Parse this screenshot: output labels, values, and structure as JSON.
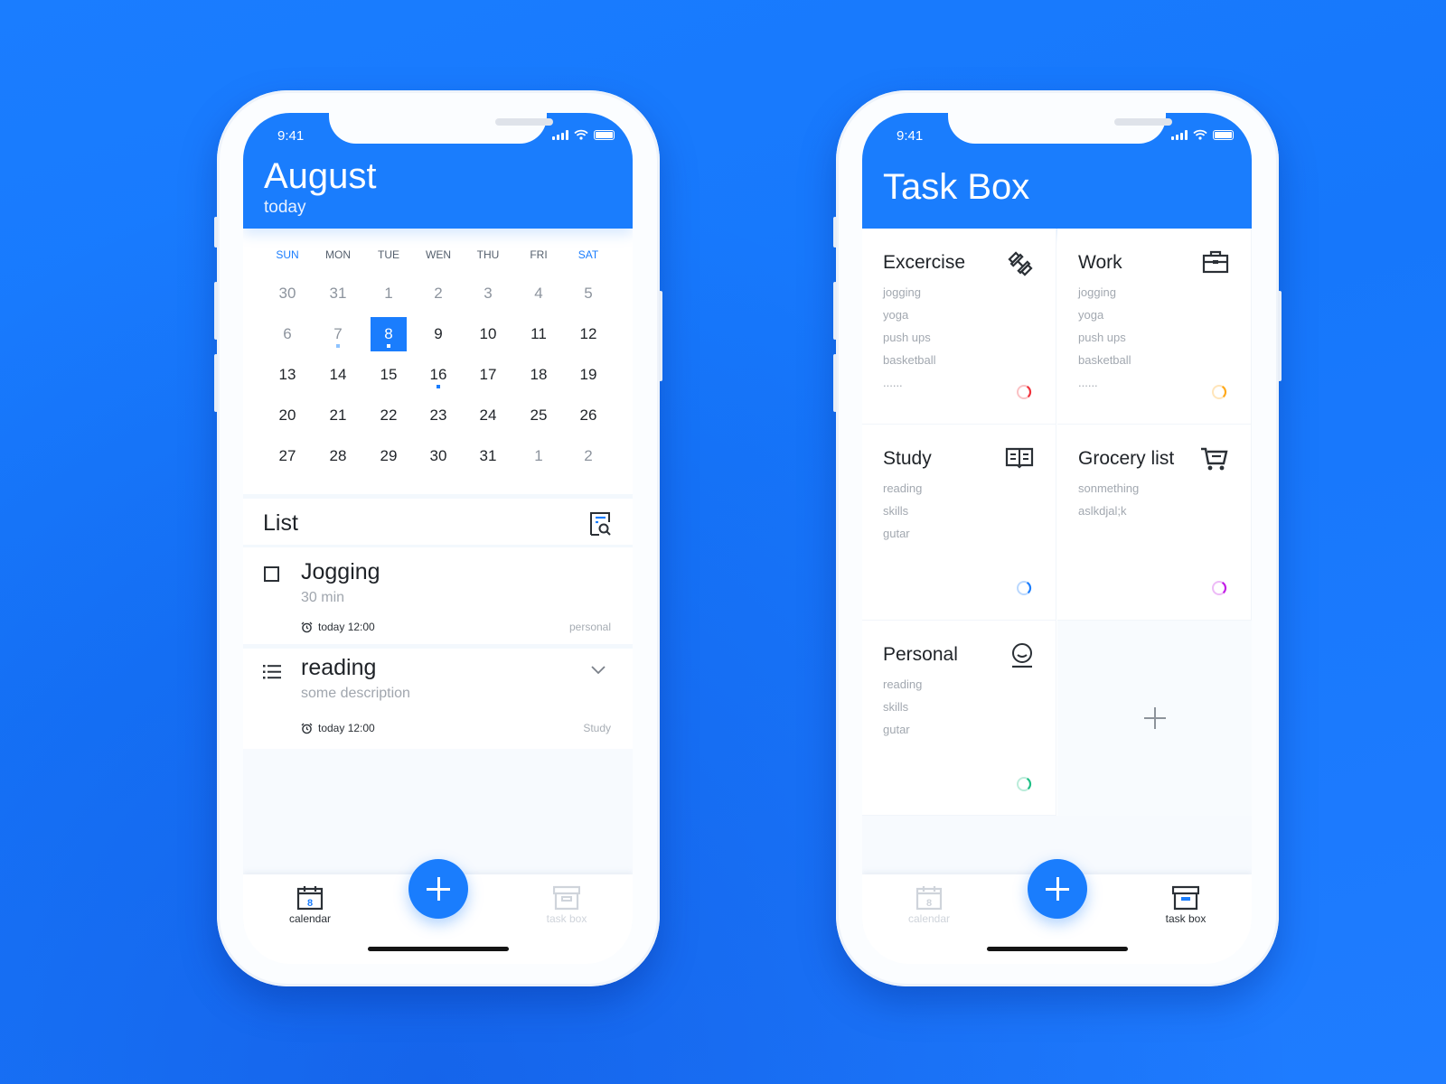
{
  "colors": {
    "brand": "#1a7dfd",
    "background": "#1a7dff"
  },
  "calendar_phone": {
    "status": {
      "time": "9:41"
    },
    "header": {
      "title": "August",
      "subtitle": "today"
    },
    "weekdays": [
      "SUN",
      "MON",
      "TUE",
      "WEN",
      "THU",
      "FRI",
      "SAT"
    ],
    "weeks": [
      [
        {
          "d": "30",
          "m": true
        },
        {
          "d": "31",
          "m": true
        },
        {
          "d": "1",
          "m": true
        },
        {
          "d": "2",
          "m": true
        },
        {
          "d": "3",
          "m": true
        },
        {
          "d": "4",
          "m": true
        },
        {
          "d": "5",
          "m": true
        }
      ],
      [
        {
          "d": "6",
          "m": true
        },
        {
          "d": "7",
          "m": true,
          "dot": "light"
        },
        {
          "d": "8",
          "sel": true,
          "dot": "white"
        },
        {
          "d": "9"
        },
        {
          "d": "10"
        },
        {
          "d": "11"
        },
        {
          "d": "12"
        }
      ],
      [
        {
          "d": "13"
        },
        {
          "d": "14"
        },
        {
          "d": "15"
        },
        {
          "d": "16",
          "dot": "blue"
        },
        {
          "d": "17"
        },
        {
          "d": "18"
        },
        {
          "d": "19"
        }
      ],
      [
        {
          "d": "20"
        },
        {
          "d": "21"
        },
        {
          "d": "22"
        },
        {
          "d": "23"
        },
        {
          "d": "24"
        },
        {
          "d": "25"
        },
        {
          "d": "26"
        }
      ],
      [
        {
          "d": "27"
        },
        {
          "d": "28"
        },
        {
          "d": "29"
        },
        {
          "d": "30"
        },
        {
          "d": "31"
        },
        {
          "d": "1",
          "m": true
        },
        {
          "d": "2",
          "m": true
        }
      ]
    ],
    "list": {
      "title": "List",
      "items": [
        {
          "title": "Jogging",
          "desc": "30 min",
          "time": "today 12:00",
          "tag": "personal",
          "icon": "checkbox-icon"
        },
        {
          "title": "reading",
          "desc": "some description",
          "time": "today 12:00",
          "tag": "Study",
          "icon": "list-icon"
        }
      ]
    },
    "nav": {
      "calendar": "calendar",
      "taskbox": "task box",
      "calendar_day": "8",
      "active": "calendar"
    }
  },
  "taskbox_phone": {
    "status": {
      "time": "9:41"
    },
    "header": {
      "title": "Task Box"
    },
    "tiles": [
      {
        "title": "Excercise",
        "icon": "dumbbell-icon",
        "items": [
          "jogging",
          "yoga",
          "push ups",
          "basketball",
          "......"
        ],
        "ring_color": "#f0323c",
        "progress": 0.3
      },
      {
        "title": "Work",
        "icon": "briefcase-icon",
        "items": [
          "jogging",
          "yoga",
          "push ups",
          "basketball",
          "......"
        ],
        "ring_color": "#ffa91a",
        "progress": 0.3
      },
      {
        "title": "Study",
        "icon": "book-icon",
        "items": [
          "reading",
          "skills",
          "gutar"
        ],
        "ring_color": "#1a7dfd",
        "progress": 0.3
      },
      {
        "title": "Grocery list",
        "icon": "cart-icon",
        "items": [
          "sonmething",
          "aslkdjal;k"
        ],
        "ring_color": "#c21ee6",
        "progress": 0.3
      },
      {
        "title": "Personal",
        "icon": "face-icon",
        "items": [
          "reading",
          "skills",
          "gutar"
        ],
        "ring_color": "#1fbf86",
        "progress": 0.3
      }
    ],
    "nav": {
      "calendar": "calendar",
      "taskbox": "task box",
      "calendar_day": "8",
      "active": "task box"
    }
  }
}
